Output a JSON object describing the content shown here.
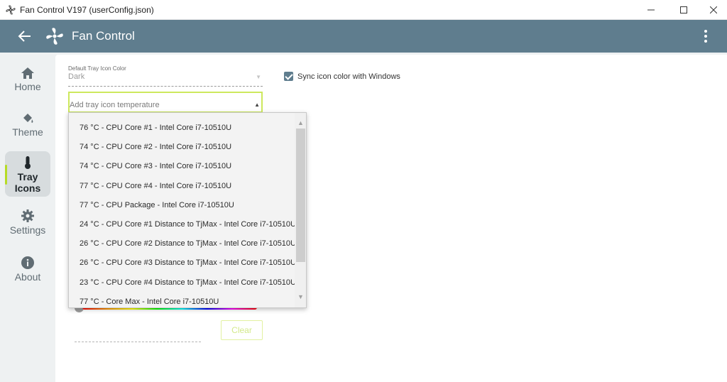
{
  "window": {
    "title": "Fan Control V197 (userConfig.json)",
    "controls": [
      "minimize",
      "maximize",
      "close"
    ]
  },
  "appbar": {
    "title": "Fan Control",
    "back_icon": "arrow-left-icon",
    "logo_icon": "fan-icon",
    "menu_icon": "more-vertical-icon",
    "color": "#5f7d8e"
  },
  "nav": {
    "items": [
      {
        "label": "Home",
        "icon": "home-icon"
      },
      {
        "label": "Theme",
        "icon": "paint-bucket-icon"
      },
      {
        "label": "Tray\nIcons",
        "label_line1": "Tray",
        "label_line2": "Icons",
        "icon": "thermometer-icon",
        "active": true
      },
      {
        "label": "Settings",
        "icon": "gear-icon"
      },
      {
        "label": "About",
        "icon": "info-icon"
      }
    ],
    "accent": "#b6dc25"
  },
  "tray_settings": {
    "default_color_label": "Default Tray Icon Color",
    "default_color_value": "Dark",
    "sync_label": "Sync icon color with Windows",
    "sync_checked": true,
    "add_temp_placeholder": "Add tray icon temperature",
    "clear_label": "Clear"
  },
  "dropdown": {
    "options": [
      "76 °C - CPU Core #1 - Intel Core i7-10510U",
      "74 °C - CPU Core #2 - Intel Core i7-10510U",
      "74 °C - CPU Core #3 - Intel Core i7-10510U",
      "77 °C - CPU Core #4 - Intel Core i7-10510U",
      "77 °C - CPU Package - Intel Core i7-10510U",
      "24 °C - CPU Core #1 Distance to TjMax - Intel Core i7-10510U",
      "26 °C - CPU Core #2 Distance to TjMax - Intel Core i7-10510U",
      "26 °C - CPU Core #3 Distance to TjMax - Intel Core i7-10510U",
      "23 °C - CPU Core #4 Distance to TjMax - Intel Core i7-10510U",
      "77 °C - Core Max - Intel Core i7-10510U"
    ],
    "scroll_position": 0.0
  }
}
